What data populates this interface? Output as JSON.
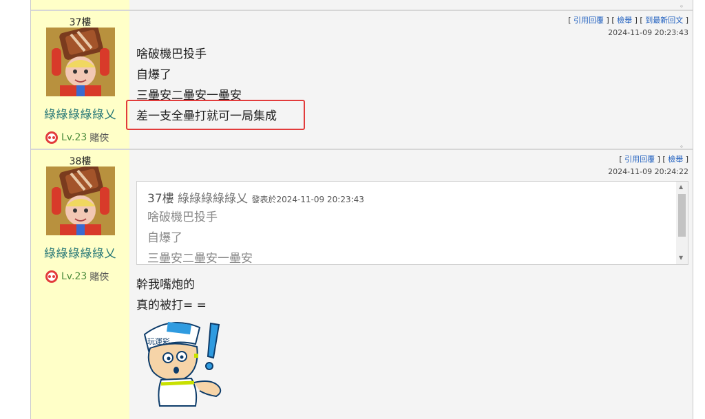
{
  "posts": [
    {
      "floor": "37樓",
      "username": "綠綠綠綠綠乂",
      "level": "Lv.23",
      "rank": "賭俠",
      "links": [
        "引用回覆",
        "檢舉",
        "到最新回文"
      ],
      "time": "2024-11-09 20:23:43",
      "lines": [
        "啥破機巴投手",
        "自爆了",
        "三壘安二壘安一壘安",
        "差一支全壘打就可一局集成"
      ],
      "highlighted_line_index": 3
    },
    {
      "floor": "38樓",
      "username": "綠綠綠綠綠乂",
      "level": "Lv.23",
      "rank": "賭俠",
      "links": [
        "引用回覆",
        "檢舉"
      ],
      "time": "2024-11-09 20:24:22",
      "quote": {
        "floor": "37樓",
        "username": "綠綠綠綠綠乂",
        "meta": "發表於2024-11-09 20:23:43",
        "lines": [
          "啥破機巴投手",
          "自爆了",
          "三壘安二壘安一壘安"
        ]
      },
      "lines": [
        "幹我嘴炮的",
        "真的被打= ="
      ],
      "sticker": "sticker-surprised-boy-with-cap",
      "sticker_cap_text": "玩運彩"
    }
  ],
  "end_mark": "。",
  "colors": {
    "user_sidebar": "#ffffc8",
    "username": "#2b7a78",
    "highlight": "#e23b3b",
    "link": "#1f5fbf"
  }
}
